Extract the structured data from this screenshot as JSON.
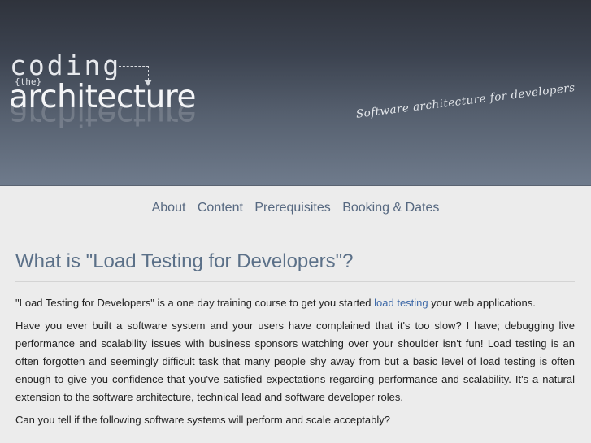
{
  "header": {
    "logo_coding": "coding",
    "logo_the": "{the}",
    "logo_architecture": "architecture",
    "tagline": "Software architecture for developers"
  },
  "nav": {
    "items": [
      {
        "label": "About"
      },
      {
        "label": "Content"
      },
      {
        "label": "Prerequisites"
      },
      {
        "label": "Booking & Dates"
      }
    ]
  },
  "main": {
    "title": "What is \"Load Testing for Developers\"?",
    "p1": {
      "before": "\"Load Testing for Developers\" is a one day training course to get you started ",
      "link": "load testing",
      "after": " your web applications."
    },
    "p2": "Have you ever built a software system and your users have complained that it's too slow? I have; debugging live performance and scalability issues with business sponsors watching over your shoulder isn't fun! Load testing is an often forgotten and seemingly difficult task that many people shy away from but a basic level of load testing is often enough to give you confidence that you've satisfied expectations regarding performance and scalability. It's a natural extension to the software architecture, technical lead and software developer roles.",
    "p3": "Can you tell if the following software systems will perform and scale acceptably?"
  }
}
